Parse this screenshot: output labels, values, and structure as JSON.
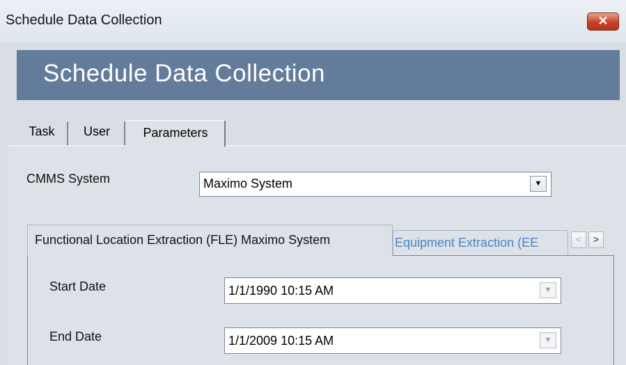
{
  "window": {
    "title": "Schedule Data Collection",
    "close_glyph": "✕"
  },
  "banner": {
    "heading": "Schedule Data Collection"
  },
  "tabs": [
    {
      "label": "Task",
      "active": false
    },
    {
      "label": "User",
      "active": false
    },
    {
      "label": "Parameters",
      "active": true
    }
  ],
  "parameters": {
    "cmms_label": "CMMS System",
    "cmms_value": "Maximo System",
    "sub_tabs": [
      {
        "label": "Functional Location Extraction (FLE) Maximo System",
        "active": true
      },
      {
        "label": "Equipment Extraction (EE",
        "active": false
      }
    ],
    "scroll_left_glyph": "<",
    "scroll_right_glyph": ">",
    "start_date_label": "Start Date",
    "start_date_value": "1/1/1990 10:15 AM",
    "end_date_label": "End Date",
    "end_date_value": "1/1/2009 10:15 AM"
  },
  "colors": {
    "banner_bg": "#647c9b",
    "panel_bg": "#dde2e8",
    "inactive_tab_text": "#4a84c4",
    "close_button": "#c8412a"
  },
  "icons": {
    "dropdown": "chevron-down-icon",
    "close": "close-icon",
    "scroll_left": "chevron-left-icon",
    "scroll_right": "chevron-right-icon"
  }
}
